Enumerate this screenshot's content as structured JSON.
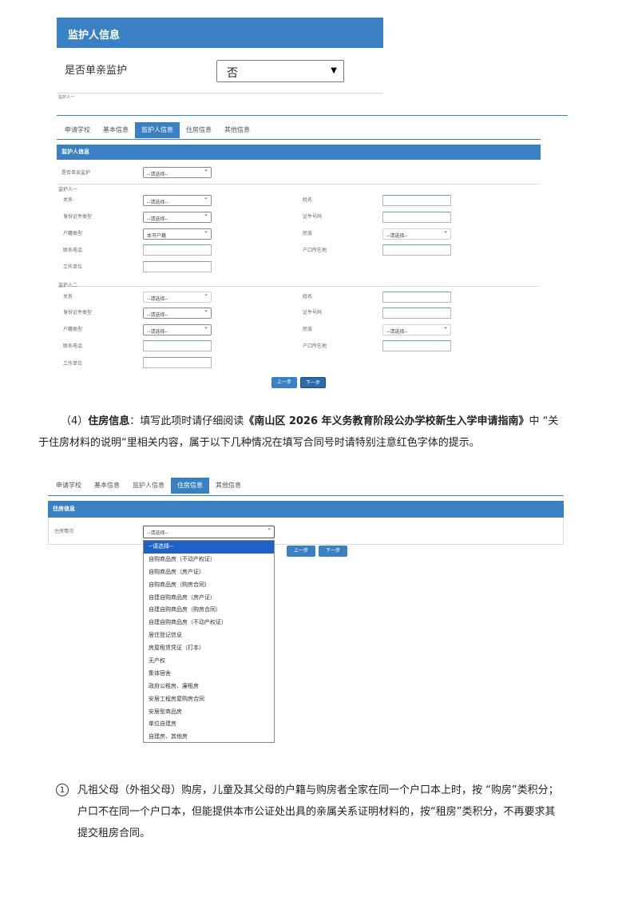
{
  "shot1": {
    "header": "监护人信息",
    "single_parent_label": "是否单亲监护",
    "single_parent_value": "否",
    "cut_text": "监护人一"
  },
  "shot2": {
    "tabs": [
      "申请学校",
      "基本信息",
      "监护人信息",
      "住房信息",
      "其他信息"
    ],
    "active_tab": "监护人信息",
    "section_title": "监护人信息",
    "single_label": "是否单亲监护",
    "placeholder": "--请选择--",
    "guardian1": {
      "title": "监护人一",
      "relation_label": "关系",
      "idtype_label": "身份证件类型",
      "hukou_label": "户籍类型",
      "hukou_value": "本市户籍",
      "phone_label": "联系电话",
      "work_label": "工作单位",
      "name_label": "姓名",
      "idnum_label": "证件号码",
      "ethnic_label": "民族",
      "ethnic_value": "--请选择--",
      "address_label": "户口所在地"
    },
    "guardian2": {
      "title": "监护人二",
      "relation_label": "关系",
      "relation_value": "--请选择--",
      "idtype_label": "身份证件类型",
      "hukou_label": "户籍类型",
      "phone_label": "联系电话",
      "work_label": "工作单位",
      "name_label": "姓名",
      "idnum_label": "证件号码",
      "ethnic_label": "民族",
      "address_label": "户口所在地"
    },
    "prev_button": "上一步",
    "next_button": "下一步"
  },
  "paragraph": {
    "prefix": "（4）",
    "bold1": "住房信息",
    "mid1": "：填写此项时请仔细阅读",
    "bold2": "《南山区 2026 年义务教育阶段公办学校新生入学申请指南》",
    "mid2": "中 “关",
    "line2": "于住房材料的说明“里相关内容，属于以下几种情况在填写合同号时请特别注意红色字体的提示。"
  },
  "shot3": {
    "tabs": [
      "申请学校",
      "基本信息",
      "监护人信息",
      "住房信息",
      "其他信息"
    ],
    "active_tab": "住房信息",
    "section_title": "住房信息",
    "housing_label": "住房情况",
    "select_value": "--请选择--",
    "options": [
      "--请选择--",
      "自购商品房（不动产权证）",
      "自购商品房（房产证）",
      "自购商品房（购房合同）",
      "自建自购商品房（房产证）",
      "自建自购商品房（购房合同）",
      "自建自购商品房（不动产权证）",
      "居住登记信息",
      "房屋租赁凭证（打本）",
      "无产权",
      "集体宿舍",
      "政府公租房、廉租房",
      "安居工程房屋购房合同",
      "安居型商品房",
      "单位自建房",
      "自建房、其他房"
    ],
    "prev_button": "上一步",
    "next_button": "下一步"
  },
  "note": {
    "number": "1",
    "line1": "凡祖父母（外祖父母）购房，儿童及其父母的户籍与购房者全家在同一个户口本上时，按 “购房”类积分；",
    "line2": "户口不在同一个户口本，但能提供本市公证处出具的亲属关系证明材料的，按“租房”类积分，不再要求其",
    "line3": "提交租房合同。"
  }
}
